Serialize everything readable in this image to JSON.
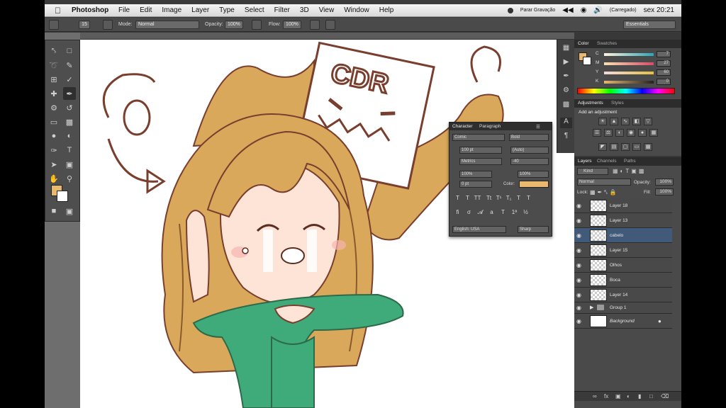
{
  "menubar": {
    "apple": "",
    "app": "Photoshop",
    "items": [
      "File",
      "Edit",
      "Image",
      "Layer",
      "Type",
      "Select",
      "Filter",
      "3D",
      "View",
      "Window",
      "Help"
    ],
    "status": {
      "recording": "Parar Gravação",
      "battery": "(Carregado)",
      "clock": "sex 20:21"
    }
  },
  "options": {
    "size": "15",
    "mode_label": "Mode:",
    "mode_value": "Normal",
    "opacity_label": "Opacity:",
    "opacity_value": "100%",
    "flow_label": "Flow:",
    "flow_value": "100%",
    "workspace": "Essentials"
  },
  "color_panel": {
    "tabs": [
      "Color",
      "Swatches"
    ],
    "sliders": [
      {
        "ch": "C",
        "value": "7",
        "color": "#e0a060"
      },
      {
        "ch": "M",
        "value": "27",
        "color": "#d85a8a"
      },
      {
        "ch": "Y",
        "value": "60",
        "color": "#e0c040"
      },
      {
        "ch": "K",
        "value": "0",
        "color": "#555555"
      }
    ],
    "foreground": "#e8b96f"
  },
  "adjustments": {
    "tabs": [
      "Adjustments",
      "Styles"
    ],
    "title": "Add an adjustment"
  },
  "layers_panel": {
    "tabs": [
      "Layers",
      "Channels",
      "Paths"
    ],
    "filter": "Kind",
    "blend": "Normal",
    "opacity_label": "Opacity:",
    "opacity": "100%",
    "lock_label": "Lock:",
    "fill_label": "Fill:",
    "fill": "100%",
    "layers": [
      {
        "name": "Layer 18",
        "selected": false
      },
      {
        "name": "Layer 13",
        "selected": false
      },
      {
        "name": "cabelo",
        "selected": true
      },
      {
        "name": "Layer 15",
        "selected": false
      },
      {
        "name": "Olhos",
        "selected": false
      },
      {
        "name": "Boca",
        "selected": false
      },
      {
        "name": "Layer 14",
        "selected": false
      },
      {
        "name": "Group 1",
        "selected": false
      },
      {
        "name": "Background",
        "selected": false
      }
    ]
  },
  "character_panel": {
    "tabs": [
      "Character",
      "Paragraph"
    ],
    "font": "Comic",
    "style": "Bold",
    "size": "100 pt",
    "leading": "(Auto)",
    "kerning": "Metrics",
    "tracking": "-40",
    "vscale": "100%",
    "hscale": "100%",
    "baseline": "0 pt",
    "color_label": "Color:",
    "color": "#e8b96f",
    "language": "English: USA",
    "aa": "Sharp"
  },
  "artwork": {
    "sign_text": "CDR"
  }
}
